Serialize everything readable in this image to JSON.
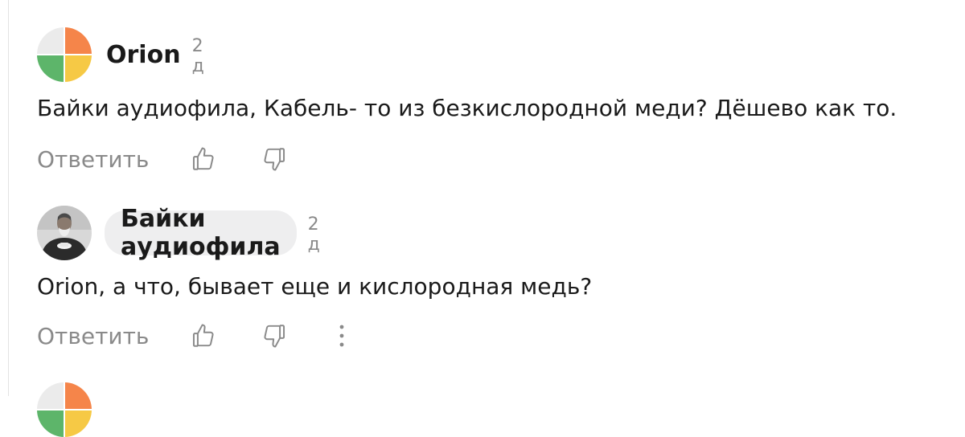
{
  "comments": [
    {
      "author": "Orion",
      "time": "2 д",
      "text": "Байки аудиофила, Кабель- то из безкислородной меди? Дёшево как то.",
      "reply_label": "Ответить",
      "avatar_icon": "four-color-quadrant-avatar",
      "avatar_colors": [
        "#f5854a",
        "#5db56a",
        "#f6c945",
        "#eeeeee"
      ]
    },
    {
      "author": "Байки аудиофила",
      "time": "2 д",
      "text": "Orion, а что, бывает еще и кислородная медь?",
      "reply_label": "Ответить",
      "avatar_icon": "bearded-man-photo-avatar"
    }
  ],
  "icons": {
    "like": "thumbs-up-icon",
    "dislike": "thumbs-down-icon",
    "more": "more-vertical-icon"
  },
  "colors": {
    "text": "#1a1a1a",
    "muted": "#8a8a8a",
    "chip_bg": "#eeeeef"
  }
}
